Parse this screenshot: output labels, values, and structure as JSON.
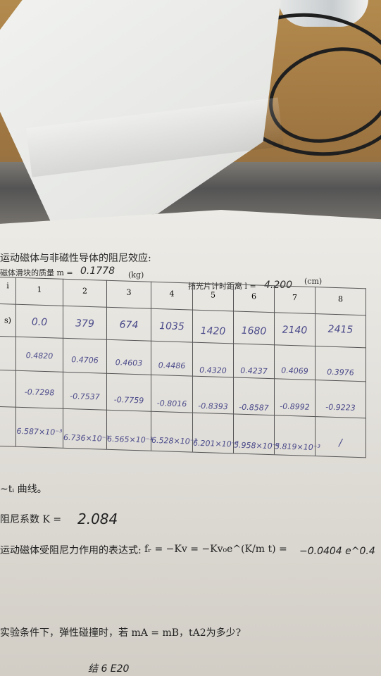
{
  "sheet": {
    "section_title": "运动磁体与非磁性导体的阻尼效应:",
    "mass_label": "磁体滑块的质量 m =",
    "mass_value": "0.1778",
    "mass_unit": "(kg)",
    "distance_label": "挡光片计时距离 l =",
    "distance_value": "4.200",
    "distance_unit": "(cm)",
    "curve_text": "~tᵢ 曲线。",
    "coefficient_label": "阻尼系数 K =",
    "coefficient_value": "2.084",
    "expression_label": "运动磁体受阻尼力作用的表达式:",
    "expression_formula": "fᵣ = −Kv = −Kv₀e^(K/m t) =",
    "expression_answer": "−0.0404 e^0.4",
    "question": "实验条件下，弹性碰撞时，若 mA = mB，tA2为多少?",
    "bottom_note": "结 6 E20"
  },
  "table": {
    "header": [
      "i",
      "1",
      "2",
      "3",
      "4",
      "5",
      "6",
      "7",
      "8"
    ],
    "row_labels": [
      "s)",
      "",
      "",
      ""
    ],
    "rows": [
      [
        "0.0",
        "379",
        "674",
        "1035",
        "1420",
        "1680",
        "2140",
        "2415"
      ],
      [
        "0.4820",
        "0.4706",
        "0.4603",
        "0.4486",
        "0.4320",
        "0.4237",
        "0.4069",
        "0.3976"
      ],
      [
        "-0.7298",
        "-0.7537",
        "-0.7759",
        "-0.8016",
        "-0.8393",
        "-0.8587",
        "-0.8992",
        "-0.9223"
      ],
      [
        "6.587×10⁻³",
        "6.736×10⁻³",
        "6.565×10⁻³",
        "6.528×10⁻³",
        "6.201×10⁻³",
        "5.958×10⁻³",
        "5.819×10⁻³",
        "/"
      ]
    ]
  }
}
